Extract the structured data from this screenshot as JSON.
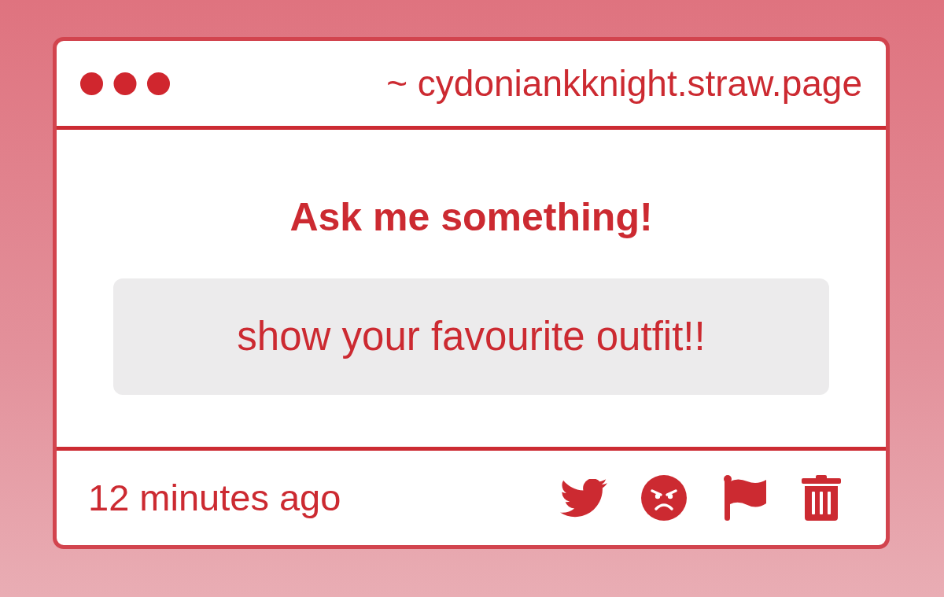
{
  "window": {
    "address": "~ cydoniankknight.straw.page"
  },
  "prompt": {
    "title": "Ask me something!",
    "question": "show your favourite outfit!!"
  },
  "footer": {
    "time": "12 minutes ago",
    "actions": [
      {
        "kind": "bird"
      },
      {
        "kind": "angry"
      },
      {
        "kind": "flag"
      },
      {
        "kind": "trash"
      }
    ]
  }
}
